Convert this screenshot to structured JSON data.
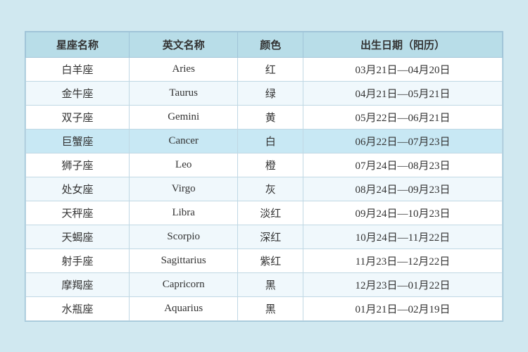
{
  "table": {
    "headers": [
      "星座名称",
      "英文名称",
      "颜色",
      "出生日期（阳历）"
    ],
    "rows": [
      {
        "chinese": "白羊座",
        "english": "Aries",
        "color": "红",
        "dates": "03月21日—04月20日",
        "highlight": false
      },
      {
        "chinese": "金牛座",
        "english": "Taurus",
        "color": "绿",
        "dates": "04月21日—05月21日",
        "highlight": false
      },
      {
        "chinese": "双子座",
        "english": "Gemini",
        "color": "黄",
        "dates": "05月22日—06月21日",
        "highlight": false
      },
      {
        "chinese": "巨蟹座",
        "english": "Cancer",
        "color": "白",
        "dates": "06月22日—07月23日",
        "highlight": true
      },
      {
        "chinese": "狮子座",
        "english": "Leo",
        "color": "橙",
        "dates": "07月24日—08月23日",
        "highlight": false
      },
      {
        "chinese": "处女座",
        "english": "Virgo",
        "color": "灰",
        "dates": "08月24日—09月23日",
        "highlight": false
      },
      {
        "chinese": "天秤座",
        "english": "Libra",
        "color": "淡红",
        "dates": "09月24日—10月23日",
        "highlight": false
      },
      {
        "chinese": "天蝎座",
        "english": "Scorpio",
        "color": "深红",
        "dates": "10月24日—11月22日",
        "highlight": false
      },
      {
        "chinese": "射手座",
        "english": "Sagittarius",
        "color": "紫红",
        "dates": "11月23日—12月22日",
        "highlight": false
      },
      {
        "chinese": "摩羯座",
        "english": "Capricorn",
        "color": "黑",
        "dates": "12月23日—01月22日",
        "highlight": false
      },
      {
        "chinese": "水瓶座",
        "english": "Aquarius",
        "color": "黑",
        "dates": "01月21日—02月19日",
        "highlight": false
      }
    ]
  }
}
